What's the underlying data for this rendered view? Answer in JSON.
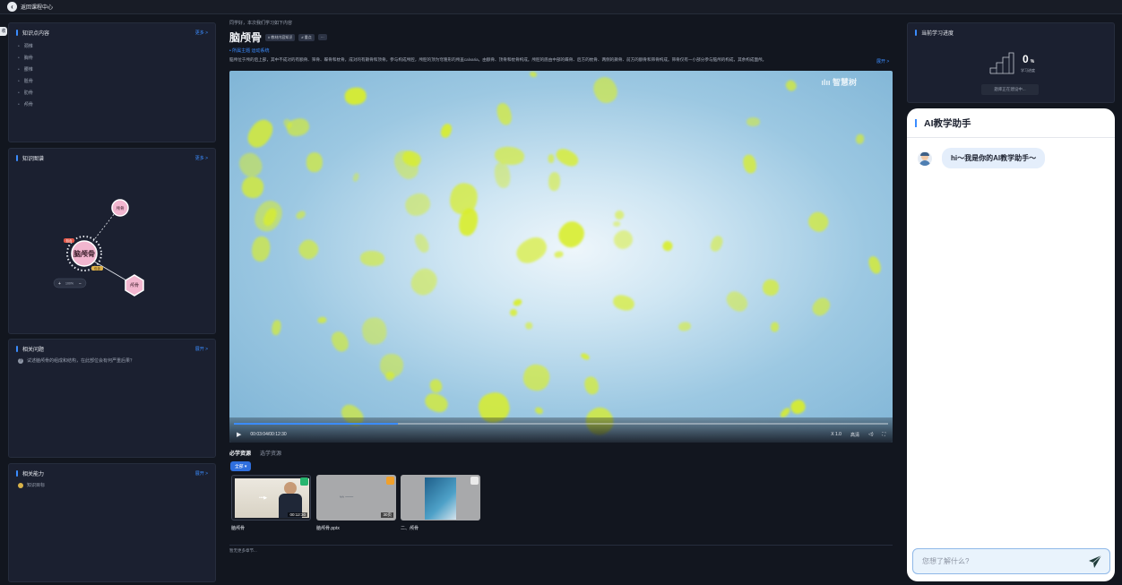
{
  "topbar": {
    "back_icon": "arrow-left-icon",
    "title": "返回课程中心"
  },
  "side_tab_label": "收",
  "left": {
    "content_panel": {
      "title": "知识点内容",
      "more": "更多 >",
      "items": [
        "颈椎",
        "胸骨",
        "腰椎",
        "骶骨",
        "肋骨",
        "颅骨"
      ]
    },
    "graph_panel": {
      "title": "知识图谱",
      "more": "更多 >",
      "center": "脑颅骨",
      "node_top": "颅骨",
      "node_hex": "颅骨",
      "tag_left": "包含",
      "tag_right": "包含",
      "zoom": "100%"
    },
    "question_panel": {
      "title": "相关问题",
      "more": "展开 >",
      "question": "试述脑颅骨的组成和结构，在此部位会有何严重后果？"
    },
    "ability_panel": {
      "title": "相关能力",
      "more": "展开 >",
      "ability": "知识目标"
    }
  },
  "main": {
    "greeting": "同学好，本次我们学习如下内容",
    "title": "脑颅骨",
    "tags": [
      "# 教材内容知识",
      "# 重点",
      "···"
    ],
    "subline": "• 所属主题 运动系统",
    "description": "脑颅位于颅的后上部，其中不成对的有额骨、筛骨、蝶骨和枕骨，成对的有颞骨和顶骨。参与构成颅腔，颅腔的顶为穹隆形的颅盖calvaria，由额骨、顶骨和枕骨构成。颅腔的底由中部的蝶骨、后方的枕骨、两侧的颞骨、前方的额骨和筛骨构成。筛骨仅有一小部分参与脑颅的构成，其余构成面颅。",
    "expand": "展开 >",
    "video": {
      "watermark": "ılıı 智慧树",
      "time": "00:03:04/00:12:30",
      "speed": "X 1.0",
      "quality": "高清",
      "progress": 0.25
    },
    "tabs": [
      "必学资源",
      "选学资源"
    ],
    "filter": "全部 ▾",
    "resources": [
      {
        "name": "脑颅骨",
        "duration": "00:12:30",
        "badge": "#27b56f"
      },
      {
        "name": "脑颅骨.pptx",
        "duration": "30页",
        "badge": "#f0a02b"
      },
      {
        "name": "二、颅骨",
        "duration": "",
        "badge": "#eaeaea"
      }
    ],
    "footer": "暂无更多章节..."
  },
  "right": {
    "progress_title": "当前学习进度",
    "progress_value": "0",
    "progress_unit": "%",
    "progress_label": "学习进度",
    "progress_status": "题库正在建设中..."
  },
  "ai": {
    "title": "AI教学助手",
    "greeting": "hi～我是你的AI教学助手～",
    "placeholder": "您想了解什么?"
  },
  "colors": {
    "accent": "#3b8cff",
    "panel": "#1b2030",
    "bg": "#12161f",
    "petal": "#d9ee2c"
  }
}
